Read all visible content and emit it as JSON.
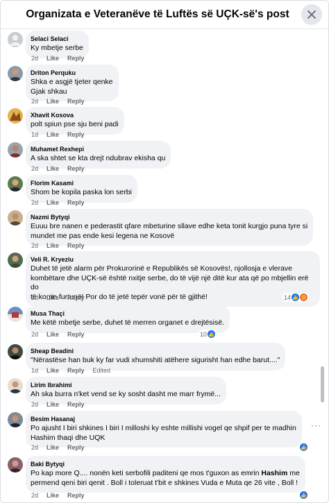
{
  "header": {
    "title": "Organizata e Veteranëve të Luftës së UÇK-së's post"
  },
  "actions": {
    "like": "Like",
    "reply": "Reply",
    "edited": "Edited"
  },
  "comments": [
    {
      "author": "Selaci Selaci",
      "text": "Ky mbetje serbe",
      "time": "2d"
    },
    {
      "author": "Driton Perquku",
      "text": "Shka e asgjë tjeter qenke\nGjak shkau",
      "time": "2d"
    },
    {
      "author": "Xhavit Kosova",
      "text": "polt spiun pse sju beni padi",
      "time": "1d"
    },
    {
      "author": "Muhamet Rexhepi",
      "text": "A ska shtet se kta drejt ndubrav ekisha qu",
      "time": "2d"
    },
    {
      "author": "Florim Kasami",
      "text": "Shom be kopila paska lon serbi",
      "time": "2d"
    },
    {
      "author": "Nazmi Bytyqi",
      "text": "Euuu bre nanen e pederastit qfare mbeturine sllave edhe keta tonit kurgjo puna tyre si\nmundet me pas ende kesi legena ne Kosovë",
      "time": "2d"
    },
    {
      "author": "Veli R. Kryeziu",
      "text": "Duhet të jetë alarm për Prokurorinë e Republikës së Kosovës!, njollosja e vlerave\nkombëtare dhe UÇK-së është nxitje serbe, do të vijë një ditë kur ata që po mbjellin erë do\ntë korrin furtunë! Por do të jetë tepër vonë për të gjithë!",
      "time": "2d",
      "reaction_count": "14"
    },
    {
      "author": "Musa Thaçi",
      "text": "Me këtë mbetje serbe, duhet të merren organet e drejtësisë.",
      "time": "2d",
      "reaction_count": "10"
    },
    {
      "author": "Sheap Beadini",
      "text": "\"Nërastëse han buk ky far vudi xhumshiti atëhere sigurisht han edhe barut....\"",
      "time": "1d"
    },
    {
      "author": "Lirim Ibrahimi",
      "text": "Ah ska burra n'ket vend se ky sosht dasht me marr frymë...",
      "time": "2d"
    },
    {
      "author": "Besim Hasanaj",
      "text": "Po ajusht I biri shkines I biri I milloshi ky eshte millishi vogel qe shpif per te madhin\nHashim thaqi dhe UQK",
      "time": "2d"
    },
    {
      "author": "Baki Bytyqi",
      "text_pre": "Po kap more Q.... nonën keti serbofili paditeni qe mos t'guxon as emrin ",
      "text_bold": "Hashim",
      "text_post": " me\npermend qeni biri qenit . Boll i toleruat t'bit e shkines Vuda e Muta qe 26 vite , Boll !",
      "time": "2d"
    }
  ]
}
